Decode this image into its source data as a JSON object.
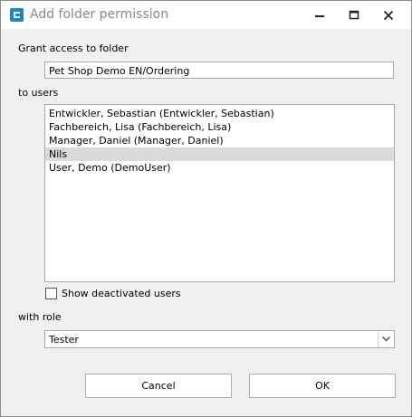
{
  "window": {
    "title": "Add folder permission",
    "icon": "app-icon",
    "controls": [
      "minimize-icon",
      "maximize-icon",
      "close-icon"
    ]
  },
  "form": {
    "grant_label": "Grant access to folder",
    "folder_value": "Pet Shop Demo EN/Ordering",
    "users_label": "to users",
    "users": [
      {
        "label": "Entwickler, Sebastian (Entwickler, Sebastian)",
        "selected": false
      },
      {
        "label": "Fachbereich, Lisa (Fachbereich, Lisa)",
        "selected": false
      },
      {
        "label": "Manager, Daniel (Manager, Daniel)",
        "selected": false
      },
      {
        "label": "Nils",
        "selected": true
      },
      {
        "label": "User, Demo (DemoUser)",
        "selected": false
      }
    ],
    "show_deactivated_label": "Show deactivated users",
    "show_deactivated_checked": false,
    "role_label": "with role",
    "role_value": "Tester"
  },
  "buttons": {
    "cancel": "Cancel",
    "ok": "OK"
  }
}
